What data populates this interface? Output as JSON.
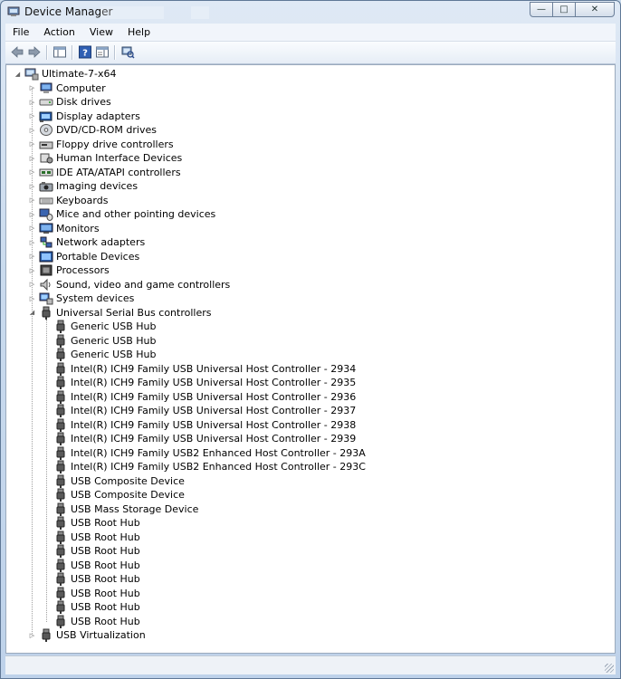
{
  "window": {
    "title": "Device Manager",
    "buttons": {
      "minimize": "—",
      "maximize": "□",
      "close": "✕"
    }
  },
  "menu": [
    "File",
    "Action",
    "View",
    "Help"
  ],
  "toolbar": {
    "icons": [
      "back-arrow-icon",
      "forward-arrow-icon",
      "properties-pane-icon",
      "help-icon",
      "show-hide-pane-icon",
      "scan-hardware-icon"
    ]
  },
  "tree": {
    "root": "Ultimate-7-x64",
    "categories": [
      {
        "label": "Computer",
        "icon": "computer-icon"
      },
      {
        "label": "Disk drives",
        "icon": "disk-drive-icon"
      },
      {
        "label": "Display adapters",
        "icon": "display-adapter-icon"
      },
      {
        "label": "DVD/CD-ROM drives",
        "icon": "dvd-drive-icon"
      },
      {
        "label": "Floppy drive controllers",
        "icon": "floppy-controller-icon"
      },
      {
        "label": "Human Interface Devices",
        "icon": "hid-icon"
      },
      {
        "label": "IDE ATA/ATAPI controllers",
        "icon": "ide-controller-icon"
      },
      {
        "label": "Imaging devices",
        "icon": "imaging-device-icon"
      },
      {
        "label": "Keyboards",
        "icon": "keyboard-icon"
      },
      {
        "label": "Mice and other pointing devices",
        "icon": "mouse-icon"
      },
      {
        "label": "Monitors",
        "icon": "monitor-icon"
      },
      {
        "label": "Network adapters",
        "icon": "network-adapter-icon"
      },
      {
        "label": "Portable Devices",
        "icon": "portable-device-icon"
      },
      {
        "label": "Processors",
        "icon": "processor-icon"
      },
      {
        "label": "Sound, video and game controllers",
        "icon": "sound-icon"
      },
      {
        "label": "System devices",
        "icon": "system-device-icon"
      }
    ],
    "expanded": {
      "label": "Universal Serial Bus controllers",
      "icon": "usb-icon",
      "children": [
        "Generic USB Hub",
        "Generic USB Hub",
        "Generic USB Hub",
        "Intel(R) ICH9 Family USB Universal Host Controller - 2934",
        "Intel(R) ICH9 Family USB Universal Host Controller - 2935",
        "Intel(R) ICH9 Family USB Universal Host Controller - 2936",
        "Intel(R) ICH9 Family USB Universal Host Controller - 2937",
        "Intel(R) ICH9 Family USB Universal Host Controller - 2938",
        "Intel(R) ICH9 Family USB Universal Host Controller - 2939",
        "Intel(R) ICH9 Family USB2 Enhanced Host Controller - 293A",
        "Intel(R) ICH9 Family USB2 Enhanced Host Controller - 293C",
        "USB Composite Device",
        "USB Composite Device",
        "USB Mass Storage Device",
        "USB Root Hub",
        "USB Root Hub",
        "USB Root Hub",
        "USB Root Hub",
        "USB Root Hub",
        "USB Root Hub",
        "USB Root Hub",
        "USB Root Hub"
      ]
    },
    "last": {
      "label": "USB Virtualization",
      "icon": "usb-icon"
    }
  }
}
